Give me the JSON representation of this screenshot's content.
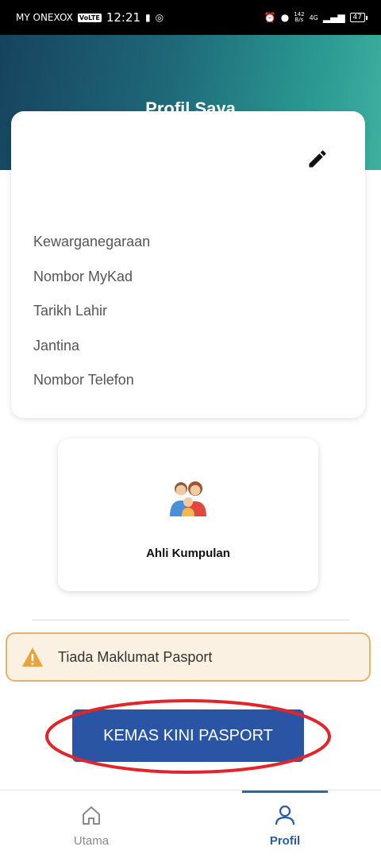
{
  "status_bar": {
    "carrier": "MY ONEXOX",
    "network_badge": "VoLTE",
    "time": "12:21",
    "speed_value": "142",
    "speed_unit": "B/s",
    "signal": "4G",
    "battery": "47"
  },
  "header": {
    "title": "Profil Saya"
  },
  "profile_card": {
    "fields": [
      {
        "label": "Kewarganegaraan"
      },
      {
        "label": "Nombor MyKad"
      },
      {
        "label": "Tarikh Lahir"
      },
      {
        "label": "Jantina"
      },
      {
        "label": "Nombor Telefon"
      }
    ]
  },
  "group_card": {
    "label": "Ahli Kumpulan",
    "icon": "family-icon"
  },
  "warning": {
    "text": "Tiada Maklumat Pasport",
    "icon": "warning-icon"
  },
  "update_button": {
    "label": "KEMAS KINI PASPORT"
  },
  "bottom_nav": {
    "items": [
      {
        "label": "Utama",
        "icon": "home-icon",
        "active": false
      },
      {
        "label": "Profil",
        "icon": "person-icon",
        "active": true
      }
    ]
  },
  "colors": {
    "primary_button": "#2a55a4",
    "warning_border": "#e6b168",
    "warning_bg": "#fbf1e3",
    "active_nav": "#2a5ba8",
    "annotation_ellipse": "#e0262b"
  }
}
